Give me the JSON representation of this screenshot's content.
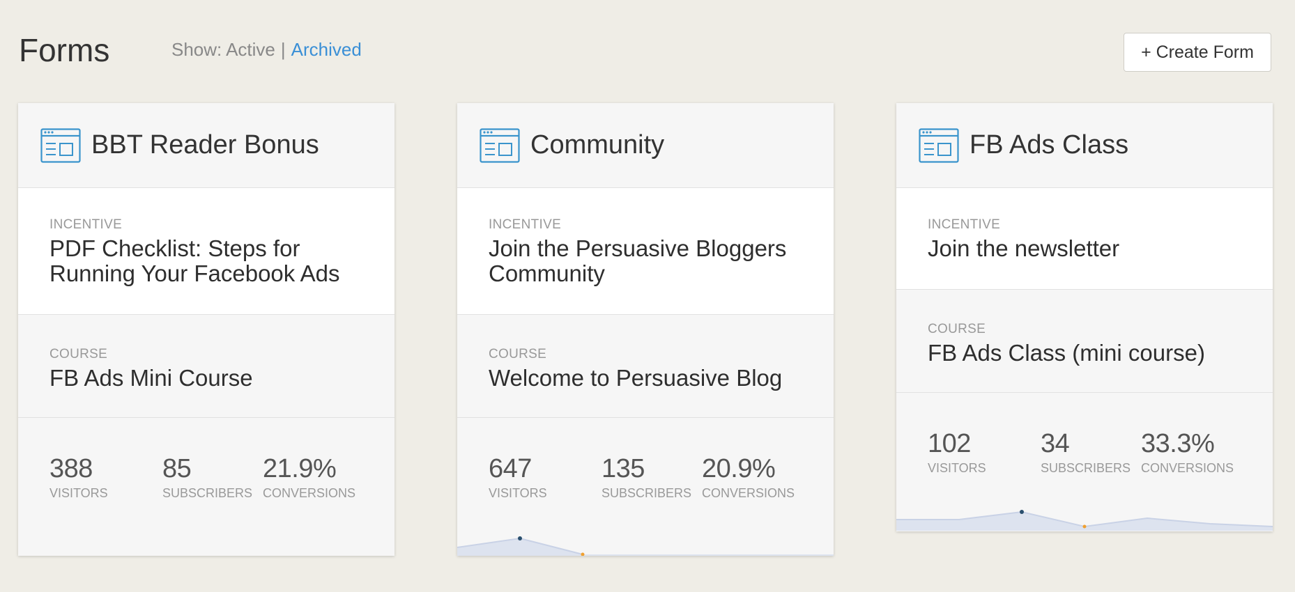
{
  "header": {
    "title": "Forms",
    "show_prefix": "Show:",
    "active_label": "Active",
    "separator": "|",
    "archived_label": "Archived",
    "create_button": "+ Create Form"
  },
  "colors": {
    "background": "#efede6",
    "accent": "#3a8fd6",
    "icon": "#3a94cc",
    "sparkline_fill": "#dde3ef"
  },
  "icons": {
    "form": "form-window-icon"
  },
  "cards": [
    {
      "title": "BBT Reader Bonus",
      "incentive_label": "INCENTIVE",
      "incentive": "PDF Checklist: Steps for Running Your Facebook Ads",
      "course_label": "COURSE",
      "course": "FB Ads Mini Course",
      "visitors": "388",
      "visitors_label": "VISITORS",
      "subscribers": "85",
      "subscribers_label": "SUBSCRIBERS",
      "conversions": "21.9%",
      "conversions_label": "CONVERSIONS"
    },
    {
      "title": "Community",
      "incentive_label": "INCENTIVE",
      "incentive": "Join the Persuasive Bloggers Community",
      "course_label": "COURSE",
      "course": "Welcome to Persuasive Blog",
      "visitors": "647",
      "visitors_label": "VISITORS",
      "subscribers": "135",
      "subscribers_label": "SUBSCRIBERS",
      "conversions": "20.9%",
      "conversions_label": "CONVERSIONS"
    },
    {
      "title": "FB Ads Class",
      "incentive_label": "INCENTIVE",
      "incentive": "Join the newsletter",
      "course_label": "COURSE",
      "course": "FB Ads Class (mini course)",
      "visitors": "102",
      "visitors_label": "VISITORS",
      "subscribers": "34",
      "subscribers_label": "SUBSCRIBERS",
      "conversions": "33.3%",
      "conversions_label": "CONVERSIONS"
    }
  ]
}
